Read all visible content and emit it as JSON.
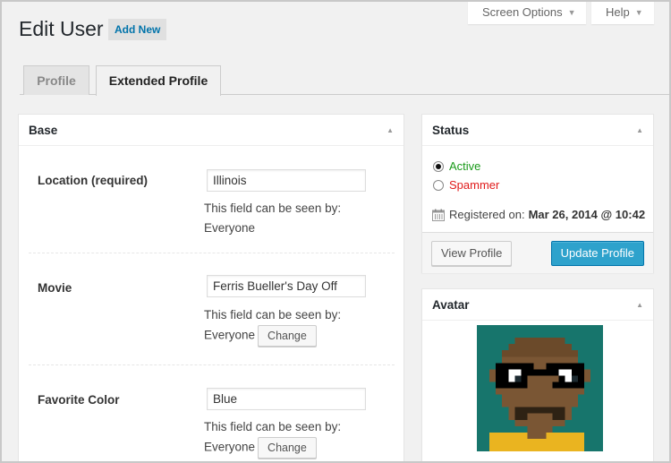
{
  "header": {
    "screen_options_label": "Screen Options",
    "help_label": "Help",
    "title": "Edit User",
    "add_new_label": "Add New"
  },
  "tabs": [
    {
      "label": "Profile",
      "active": false
    },
    {
      "label": "Extended Profile",
      "active": true
    }
  ],
  "base": {
    "title": "Base",
    "fields": [
      {
        "label": "Location (required)",
        "value": "Illinois",
        "visibility_prefix": "This field can be seen by:",
        "visibility": "Everyone",
        "change_label": null
      },
      {
        "label": "Movie",
        "value": "Ferris Bueller's Day Off",
        "visibility_prefix": "This field can be seen by:",
        "visibility": "Everyone",
        "change_label": "Change"
      },
      {
        "label": "Favorite Color",
        "value": "Blue",
        "visibility_prefix": "This field can be seen by:",
        "visibility": "Everyone",
        "change_label": "Change"
      }
    ]
  },
  "status": {
    "title": "Status",
    "options": [
      {
        "label": "Active",
        "checked": true,
        "color": "#1a9a1a"
      },
      {
        "label": "Spammer",
        "checked": false,
        "color": "#e01b1b"
      }
    ],
    "registered_label": "Registered on:",
    "registered_value": "Mar 26, 2014 @ 10:42",
    "view_profile_label": "View Profile",
    "update_profile_label": "Update Profile"
  },
  "avatar": {
    "title": "Avatar",
    "alt": "Pixel-art user avatar with glasses and goatee"
  },
  "colors": {
    "accent": "#2ea2cc",
    "link": "#0073aa"
  }
}
